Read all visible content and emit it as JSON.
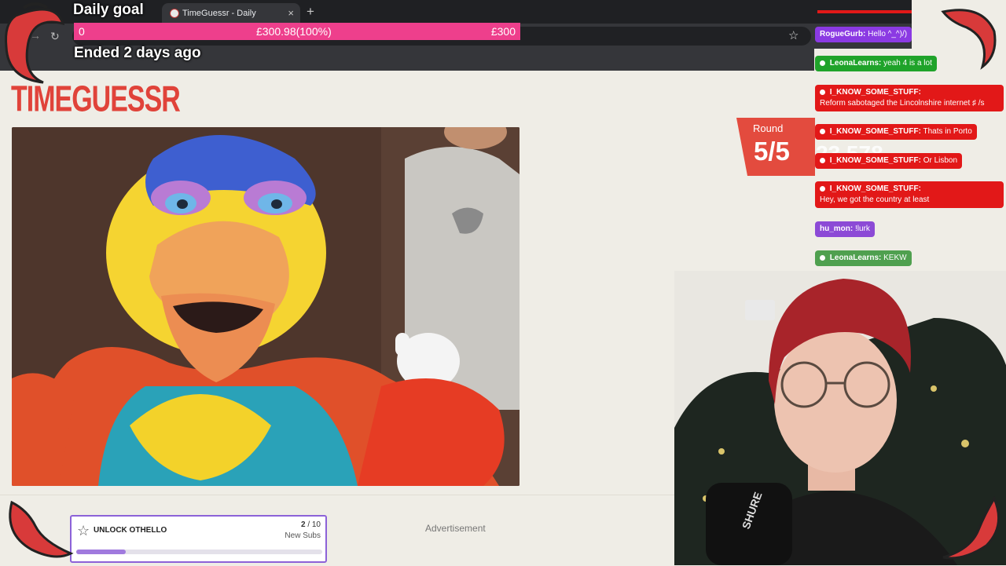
{
  "browser": {
    "tab_title": "TimeGuessr - Daily",
    "tab_close": "×",
    "new_tab": "+",
    "reload": "↻",
    "forward": "→",
    "bookmark": "☆"
  },
  "goal": {
    "title": "Daily goal",
    "min": "0",
    "current": "£300.98(100%)",
    "max": "£300",
    "progress_fraction": 1.0,
    "ended": "Ended 2 days ago",
    "color": "#ee3f8c"
  },
  "page": {
    "logo": "TIMEGUESSR",
    "brand_color": "#e0433a",
    "round_label": "Round",
    "round_value": "5/5",
    "score_partial": "23,578",
    "advertisement": "Advertisement"
  },
  "unlock": {
    "title": "UNLOCK OTHELLO",
    "count_current": "2",
    "count_sep": "/ 10",
    "count_label": "New Subs",
    "progress_fraction": 0.2
  },
  "chat": [
    {
      "user": "RogueGurb:",
      "text": "Hello ^_^)/)",
      "color": "purple"
    },
    {
      "user": "LeonaLearns:",
      "text": "yeah 4 is a lot",
      "color": "green"
    },
    {
      "user": "I_KNOW_SOME_STUFF:",
      "text": "Reform sabotaged the Lincolnshire internet ♯ /s",
      "color": "red"
    },
    {
      "user": "I_KNOW_SOME_STUFF:",
      "text": "Thats in Porto",
      "color": "red"
    },
    {
      "user": "I_KNOW_SOME_STUFF:",
      "text": "Or Lisbon",
      "color": "red"
    },
    {
      "user": "I_KNOW_SOME_STUFF:",
      "text": "Hey, we got the country at least",
      "color": "red"
    },
    {
      "user": "hu_mon:",
      "text": "!lurk",
      "color": "violet"
    },
    {
      "user": "LeonaLearns:",
      "text": "KEKW",
      "color": "lgreen"
    }
  ],
  "icons": {
    "favicon": "timeguessr-favicon",
    "unlock": "star-icon",
    "decor": "chili-pepper-icon",
    "microphone_brand": "SHURE"
  }
}
